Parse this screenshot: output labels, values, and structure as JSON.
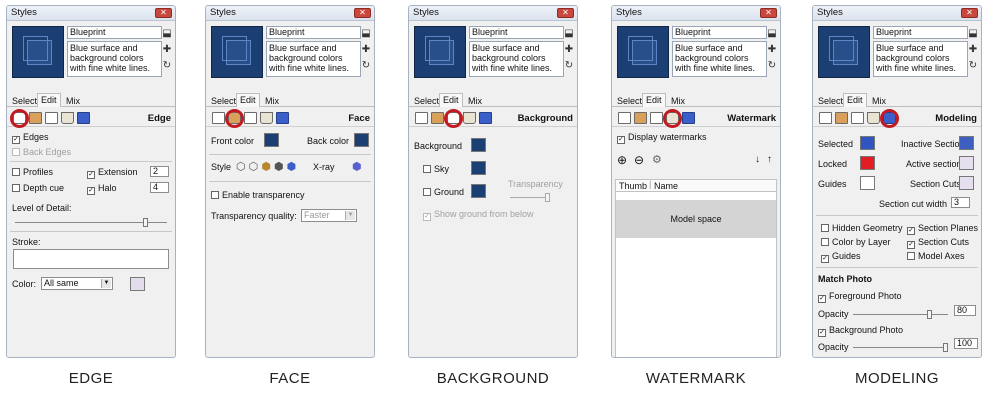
{
  "window_title": "Styles",
  "style_name": "Blueprint",
  "style_description": "Blue surface and background colors with fine white lines.",
  "tabs": [
    "Select",
    "Edit",
    "Mix"
  ],
  "captions": [
    "EDGE",
    "FACE",
    "BACKGROUND",
    "WATERMARK",
    "MODELING"
  ],
  "colors": {
    "dark_blue": "#1b3f73",
    "highlight": "#c11a22",
    "selected": "#2f55c0",
    "locked": "#e01e24",
    "inactive": "#3d5fbf"
  },
  "edge": {
    "section_title": "Edge",
    "edges": "Edges",
    "back_edges": "Back Edges",
    "profiles": "Profiles",
    "profiles_value": "2",
    "extension": "Extension",
    "extension_value": "2",
    "depth_cue": "Depth cue",
    "halo": "Halo",
    "halo_value": "4",
    "level_of_detail": "Level of Detail:",
    "stroke": "Stroke:",
    "color_label": "Color:",
    "color_value": "All same"
  },
  "face": {
    "section_title": "Face",
    "front_color": "Front color",
    "back_color": "Back color",
    "style_label": "Style",
    "xray": "X-ray",
    "enable_transparency": "Enable transparency",
    "transparency_quality": "Transparency quality:",
    "transparency_quality_value": "Faster"
  },
  "background": {
    "section_title": "Background",
    "background": "Background",
    "sky": "Sky",
    "ground": "Ground",
    "transparency": "Transparency",
    "show_ground": "Show ground from below"
  },
  "watermark": {
    "section_title": "Watermark",
    "display": "Display watermarks",
    "col_thumb": "Thumb",
    "col_name": "Name",
    "row_name": "Model space"
  },
  "modeling": {
    "section_title": "Modeling",
    "selected": "Selected",
    "inactive_section": "Inactive Section",
    "locked": "Locked",
    "active_section": "Active section",
    "guides": "Guides",
    "section_cuts": "Section Cuts",
    "section_cut_width": "Section cut width",
    "section_cut_width_value": "3",
    "hidden_geometry": "Hidden Geometry",
    "section_planes": "Section Planes",
    "color_by_layer": "Color by Layer",
    "section_cuts_cb": "Section Cuts",
    "guides_cb": "Guides",
    "model_axes": "Model Axes",
    "match_photo": "Match Photo",
    "foreground_photo": "Foreground Photo",
    "opacity": "Opacity",
    "opacity_fg_value": "80",
    "background_photo": "Background Photo",
    "opacity_bg_value": "100"
  }
}
